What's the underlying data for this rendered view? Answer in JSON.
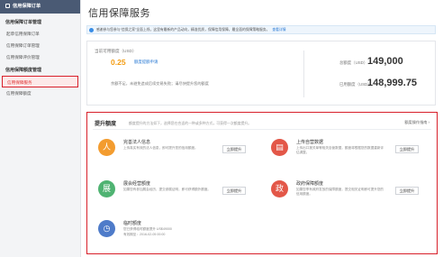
{
  "sidebar": {
    "header": "信用保障订单",
    "sections": [
      {
        "title": "信用保障订单管理",
        "items": [
          {
            "label": "起草信用保障订单"
          },
          {
            "label": "信用保障订单管理"
          },
          {
            "label": "信用保障评价管理"
          }
        ]
      },
      {
        "title": "信用保障额度管理",
        "items": [
          {
            "label": "信用保障服务",
            "active": true
          },
          {
            "label": "信用保障额度"
          }
        ]
      }
    ]
  },
  "page": {
    "title": "信用保障服务",
    "notice": "感谢参与您参与“信保之家”全面上线，这里有最新的产品动向，精准优质，保障信用保障，最全面的保障策略服务。",
    "notice_link": "查看详情"
  },
  "summary": {
    "available_label": "当前可用额度（USD）",
    "available_value": "0.25",
    "available_link": "额度提额申请",
    "note": "余额不足，未避免造成后续交易失败；请尽快提升您的额度",
    "total_label": "总额度（USD）",
    "total_value": "149,000",
    "used_label": "已用额度（USD）",
    "used_value": "148,999.75"
  },
  "boost": {
    "title": "提升额度",
    "description": "额度提升的方法如下，选择您在合适的一种或多种方式，可获得一次额度提升。",
    "help_link": "额度操作指南 ›",
    "cards": [
      {
        "title": "完善法人信息",
        "desc": "上传真实有效的法人信息，即可提升您的信用额度。",
        "button": "立即提升",
        "icon_glyph": "人",
        "color": "orange"
      },
      {
        "title": "上传自营数据",
        "desc": "上传出口报关单等相关自营数据，额度将根据您的数据重新评估调整。",
        "button": "立即提升",
        "icon_glyph": "▤",
        "color": "red"
      },
      {
        "title": "展会经营额度",
        "desc": "如果您有参加展会经历，提交参展证明，即可获得额外额度。",
        "button": "立即提升",
        "icon_glyph": "展",
        "color": "green"
      },
      {
        "title": "政府保障额度",
        "desc": "如果您享有政府发放的保障额度，提交相关证明即可提升您的信用额度。",
        "button": "立即提升",
        "icon_glyph": "政",
        "color": "red"
      },
      {
        "title": "临时额度",
        "desc": "您已获得临时额度提升 US$49000",
        "desc2": "有效期至：2016-02-05 00:00",
        "button": "",
        "icon_glyph": "◷",
        "color": "blue"
      }
    ]
  }
}
